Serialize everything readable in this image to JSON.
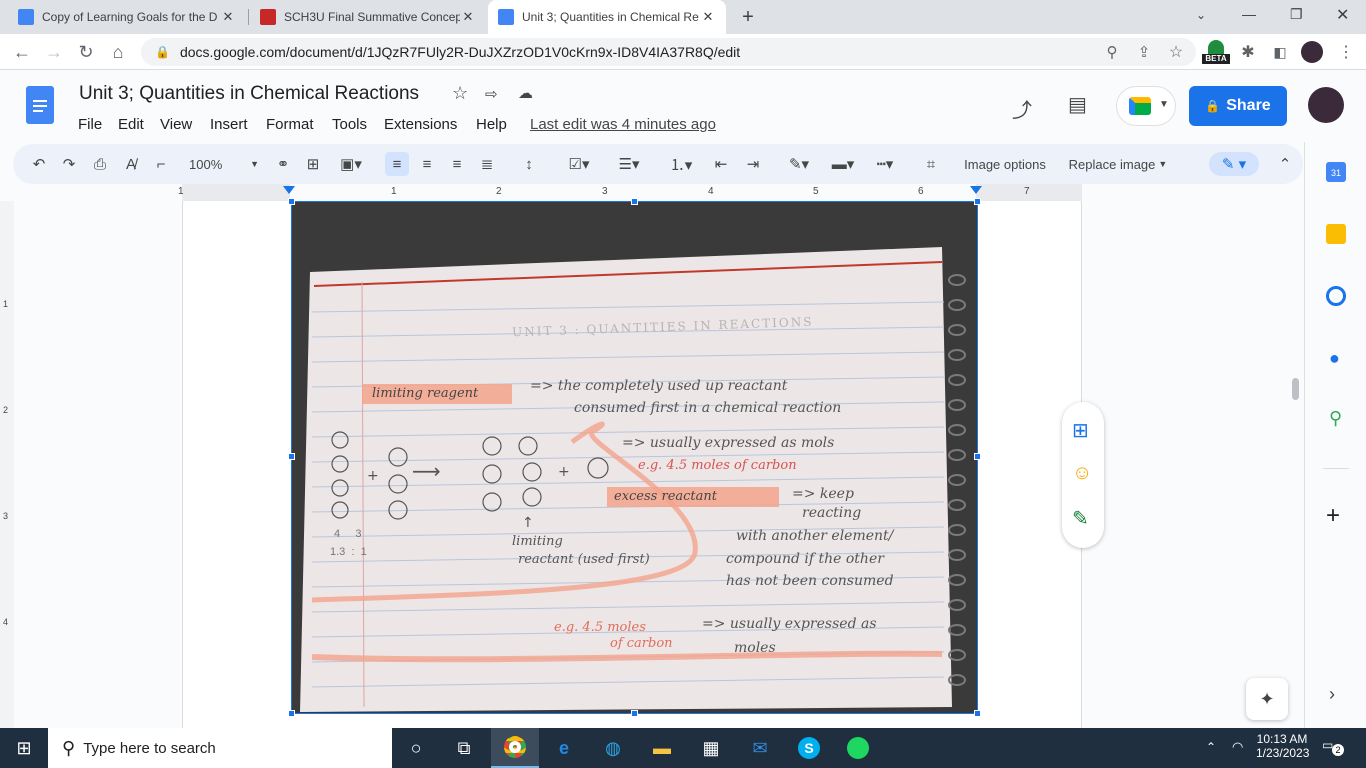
{
  "browser": {
    "tabs": [
      {
        "title": "Copy of Learning Goals for the D",
        "favicon": "docs-icon",
        "color": "#4285f4"
      },
      {
        "title": "SCH3U Final Summative Concept",
        "favicon": "brand-icon",
        "color": "#c62828"
      },
      {
        "title": "Unit 3; Quantities in Chemical Re",
        "favicon": "docs-icon",
        "color": "#4285f4"
      }
    ],
    "new_tab": "+",
    "url": "docs.google.com/document/d/1JQzR7FUly2R-DuJXZrzOD1V0cKrn9x-ID8V4IA37R8Q/edit",
    "beta_label": "BETA"
  },
  "doc": {
    "title": "Unit 3; Quantities in Chemical Reactions",
    "menu": [
      "File",
      "Edit",
      "Insert",
      "Format",
      "Tools",
      "Extensions",
      "Help"
    ],
    "menu_view": "View",
    "last_edit": "Last edit was 4 minutes ago",
    "share_label": "Share",
    "zoom": "100%",
    "image_options": "Image options",
    "replace_image": "Replace image"
  },
  "ruler": {
    "marks": [
      "1",
      "1",
      "2",
      "3",
      "4",
      "5",
      "6",
      "7"
    ],
    "vmarks": [
      "1",
      "2",
      "3",
      "4"
    ]
  },
  "note": {
    "header": "UNIT 3 : QUANTITIES IN REACTIONS",
    "limiting_label": "limiting reagent",
    "line1": "=> the completely used up reactant",
    "line2": "consumed first in a chemical reaction",
    "expressed1": "=> usually expressed as mols",
    "eg1": "e.g. 4.5 moles of carbon",
    "excess_label": "excess reactant",
    "keep": "=> keep",
    "reacting": "reacting",
    "with_another": "with another element/",
    "compound": "compound if the other",
    "consumed": "has not been consumed",
    "limiting_note1": "limiting",
    "limiting_note2": "reactant (used first)",
    "ratio1": "4     3",
    "ratio2": "1.3  :  1",
    "eg2a": "e.g. 4.5 moles",
    "eg2b": "of carbon",
    "expressed2": "=> usually expressed as",
    "moles": "moles"
  },
  "taskbar": {
    "search_placeholder": "Type here to search",
    "time": "10:13 AM",
    "date": "1/23/2023",
    "notif_count": "2"
  },
  "colors": {
    "accent": "#1a73e8",
    "docs_blue": "#4285f4",
    "highlight": "#f4a38c",
    "taskbar": "#1f2f3f"
  }
}
